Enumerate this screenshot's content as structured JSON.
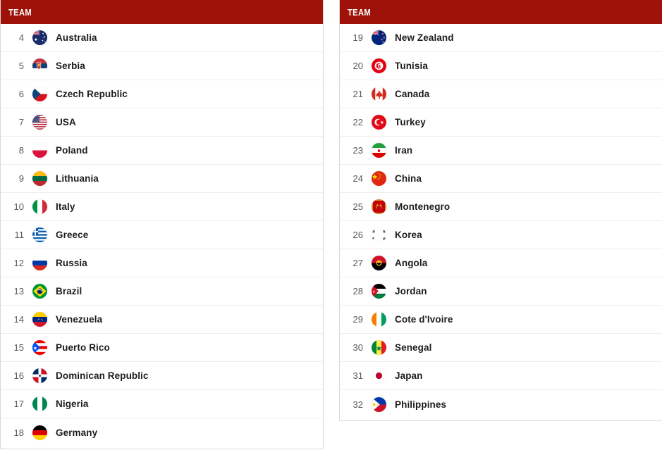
{
  "colors": {
    "header_bg": "#9e1209",
    "header_text": "#ffffff",
    "panel_border": "#d8d8d8",
    "row_divider": "#ededed",
    "rank_text": "#59595c",
    "team_text": "#1c1c1e",
    "page_bg": "#ffffff"
  },
  "panels": [
    {
      "id": "left",
      "header": {
        "label": "TEAM"
      },
      "rows": [
        {
          "rank": "4",
          "team": "Australia",
          "flag": "flag-australia"
        },
        {
          "rank": "5",
          "team": "Serbia",
          "flag": "flag-serbia"
        },
        {
          "rank": "6",
          "team": "Czech Republic",
          "flag": "flag-czech-republic"
        },
        {
          "rank": "7",
          "team": "USA",
          "flag": "flag-usa"
        },
        {
          "rank": "8",
          "team": "Poland",
          "flag": "flag-poland"
        },
        {
          "rank": "9",
          "team": "Lithuania",
          "flag": "flag-lithuania"
        },
        {
          "rank": "10",
          "team": "Italy",
          "flag": "flag-italy"
        },
        {
          "rank": "11",
          "team": "Greece",
          "flag": "flag-greece"
        },
        {
          "rank": "12",
          "team": "Russia",
          "flag": "flag-russia"
        },
        {
          "rank": "13",
          "team": "Brazil",
          "flag": "flag-brazil"
        },
        {
          "rank": "14",
          "team": "Venezuela",
          "flag": "flag-venezuela"
        },
        {
          "rank": "15",
          "team": "Puerto Rico",
          "flag": "flag-puerto-rico"
        },
        {
          "rank": "16",
          "team": "Dominican Republic",
          "flag": "flag-dominican-republic"
        },
        {
          "rank": "17",
          "team": "Nigeria",
          "flag": "flag-nigeria"
        },
        {
          "rank": "18",
          "team": "Germany",
          "flag": "flag-germany"
        }
      ]
    },
    {
      "id": "right",
      "header": {
        "label": "TEAM"
      },
      "rows": [
        {
          "rank": "19",
          "team": "New Zealand",
          "flag": "flag-new-zealand"
        },
        {
          "rank": "20",
          "team": "Tunisia",
          "flag": "flag-tunisia"
        },
        {
          "rank": "21",
          "team": "Canada",
          "flag": "flag-canada"
        },
        {
          "rank": "22",
          "team": "Turkey",
          "flag": "flag-turkey"
        },
        {
          "rank": "23",
          "team": "Iran",
          "flag": "flag-iran"
        },
        {
          "rank": "24",
          "team": "China",
          "flag": "flag-china"
        },
        {
          "rank": "25",
          "team": "Montenegro",
          "flag": "flag-montenegro"
        },
        {
          "rank": "26",
          "team": "Korea",
          "flag": "flag-korea"
        },
        {
          "rank": "27",
          "team": "Angola",
          "flag": "flag-angola"
        },
        {
          "rank": "28",
          "team": "Jordan",
          "flag": "flag-jordan"
        },
        {
          "rank": "29",
          "team": "Cote d'Ivoire",
          "flag": "flag-cote-divoire"
        },
        {
          "rank": "30",
          "team": "Senegal",
          "flag": "flag-senegal"
        },
        {
          "rank": "31",
          "team": "Japan",
          "flag": "flag-japan"
        },
        {
          "rank": "32",
          "team": "Philippines",
          "flag": "flag-philippines"
        }
      ]
    }
  ]
}
